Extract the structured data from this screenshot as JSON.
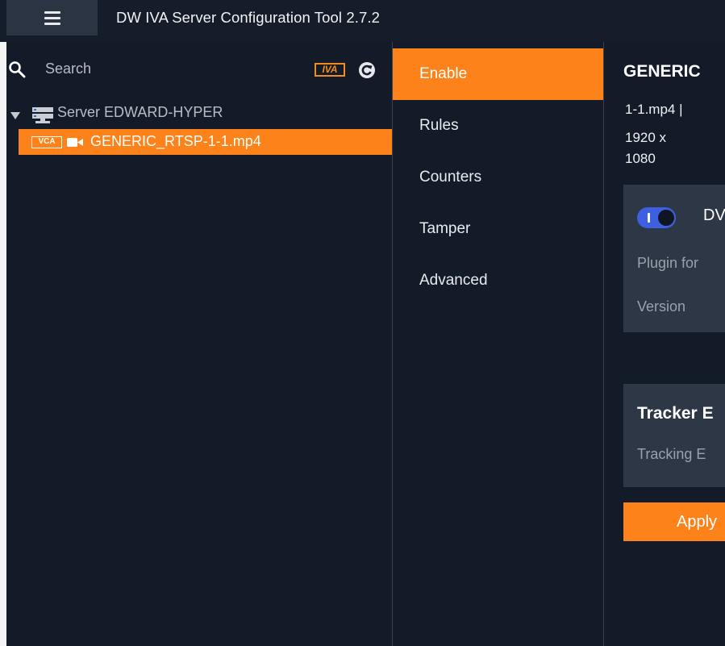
{
  "window": {
    "title": "DW IVA Server Configuration Tool 2.7.2"
  },
  "sidebar": {
    "search_label": "Search",
    "iva_badge": "IVA",
    "tree": {
      "server_label": "Server EDWARD-HYPER",
      "camera": {
        "badge": "VCA",
        "label": "GENERIC_RTSP-1-1.mp4",
        "selected": true
      }
    }
  },
  "nav": {
    "items": [
      {
        "label": "Enable",
        "active": true
      },
      {
        "label": "Rules",
        "active": false
      },
      {
        "label": "Counters",
        "active": false
      },
      {
        "label": "Tamper",
        "active": false
      },
      {
        "label": "Advanced",
        "active": false
      }
    ]
  },
  "content": {
    "title": "GENERIC",
    "meta_line1": "1-1.mp4  |",
    "meta_line2": "1920 x",
    "meta_line3": "1080",
    "plugin_card": {
      "toggle_on": true,
      "toggle_label": "DV",
      "description": "Plugin for",
      "version_label": "Version"
    },
    "tracker_card": {
      "title": "Tracker E",
      "subtitle": "Tracking E"
    },
    "apply_label": "Apply"
  },
  "colors": {
    "accent": "#fc8219",
    "background": "#131b28",
    "card": "#2e3746",
    "toggle": "#3d5fe0"
  }
}
